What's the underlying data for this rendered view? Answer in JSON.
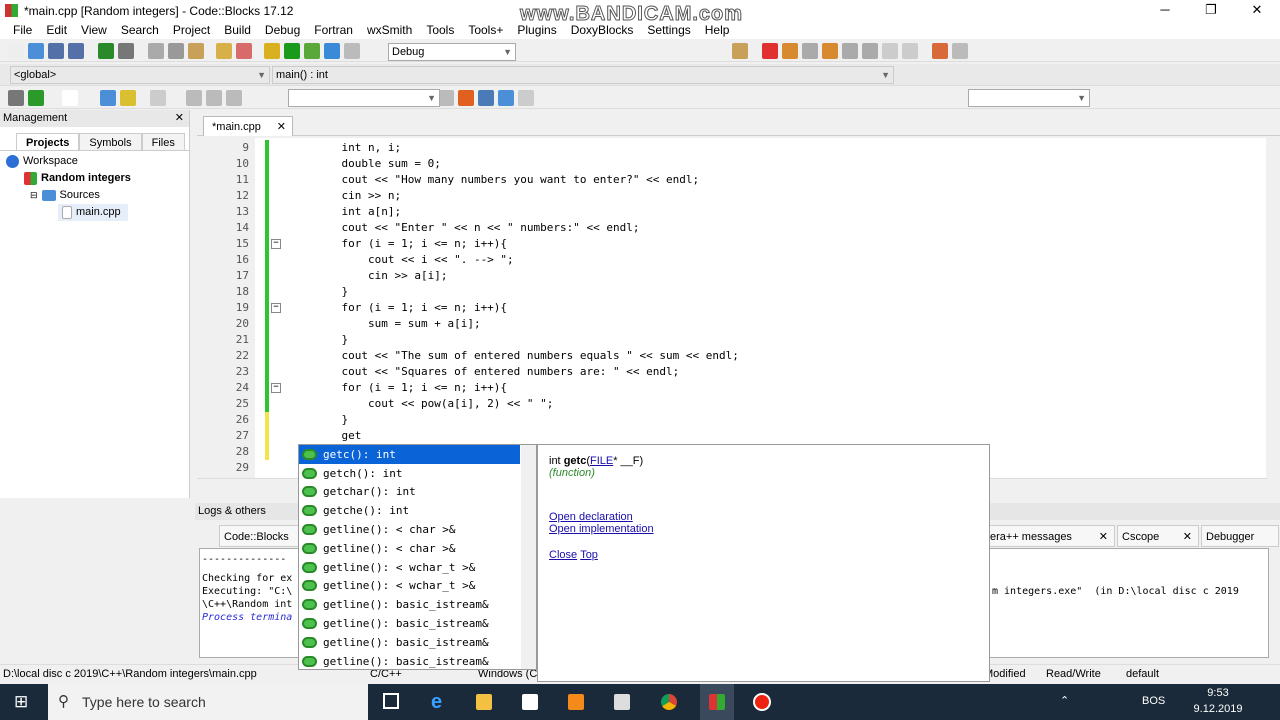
{
  "window": {
    "title": "*main.cpp [Random integers] - Code::Blocks 17.12",
    "min": "─",
    "max": "❐",
    "close": "✕",
    "watermark": "www.BANDICAM.com"
  },
  "menu": [
    "File",
    "Edit",
    "View",
    "Search",
    "Project",
    "Build",
    "Debug",
    "Fortran",
    "wxSmith",
    "Tools",
    "Tools+",
    "Plugins",
    "DoxyBlocks",
    "Settings",
    "Help"
  ],
  "toolbar": {
    "build_target": "Debug",
    "scope": "<global>",
    "function": "main() : int",
    "search_value": ""
  },
  "management": {
    "title": "Management",
    "tabs": [
      "Projects",
      "Symbols",
      "Files"
    ],
    "tree": [
      "Workspace",
      "Random integers",
      "Sources",
      "main.cpp"
    ]
  },
  "editor": {
    "tab": "*main.cpp",
    "lines": [
      {
        "n": "9",
        "t": "    int n, i;"
      },
      {
        "n": "10",
        "t": "    double sum = 0;"
      },
      {
        "n": "11",
        "t": "    cout << \"How many numbers you want to enter?\" << endl;"
      },
      {
        "n": "12",
        "t": "    cin >> n;"
      },
      {
        "n": "13",
        "t": "    int a[n];"
      },
      {
        "n": "14",
        "t": "    cout << \"Enter \" << n << \" numbers:\" << endl;"
      },
      {
        "n": "15",
        "t": "    for (i = 1; i <= n; i++){"
      },
      {
        "n": "16",
        "t": "        cout << i << \". --> \";"
      },
      {
        "n": "17",
        "t": "        cin >> a[i];"
      },
      {
        "n": "18",
        "t": "    }"
      },
      {
        "n": "19",
        "t": "    for (i = 1; i <= n; i++){"
      },
      {
        "n": "20",
        "t": "        sum = sum + a[i];"
      },
      {
        "n": "21",
        "t": "    }"
      },
      {
        "n": "22",
        "t": "    cout << \"The sum of entered numbers equals \" << sum << endl;"
      },
      {
        "n": "23",
        "t": "    cout << \"Squares of entered numbers are: \" << endl;"
      },
      {
        "n": "24",
        "t": "    for (i = 1; i <= n; i++){"
      },
      {
        "n": "25",
        "t": "        cout << pow(a[i], 2) << \" \";"
      },
      {
        "n": "26",
        "t": "    }"
      },
      {
        "n": "27",
        "t": "    get"
      },
      {
        "n": "28",
        "t": ""
      },
      {
        "n": "29",
        "t": ""
      }
    ]
  },
  "autocomplete": [
    "getc(): int",
    "getch(): int",
    "getchar(): int",
    "getche(): int",
    "getline(): < char >&",
    "getline(): < char >&",
    "getline(): < wchar_t >&",
    "getline(): < wchar_t >&",
    "getline(): basic_istream&",
    "getline(): basic_istream&",
    "getline(): basic_istream&",
    "getline(): basic_istream&"
  ],
  "doc": {
    "sig_pre": "int ",
    "sig_name": "getc",
    "sig_open": "(",
    "sig_type": "FILE",
    "sig_rest": "* __F)",
    "kind": "(function)",
    "open_decl": "Open declaration",
    "open_impl": "Open implementation",
    "close": "Close",
    "top": "Top"
  },
  "logs": {
    "title": "Logs & others",
    "tabs": [
      "Code::Blocks",
      "era++ messages",
      "Cscope",
      "Debugger"
    ],
    "lines": [
      "--------------",
      "Checking for ex",
      "Executing: \"C:\\",
      "\\C++\\Random int",
      "Process termina"
    ],
    "right_line": "m integers.exe\"  (in D:\\local disc c 2019"
  },
  "status": {
    "path": "D:\\local disc c 2019\\C++\\Random integers\\main.cpp",
    "lang": "C/C++",
    "eol": "Windows (C",
    "modified": "Modified",
    "rw": "Read/Write",
    "profile": "default"
  },
  "taskbar": {
    "search": "Type here to search",
    "lang": "BOS",
    "time": "9:53",
    "date": "9.12.2019"
  }
}
